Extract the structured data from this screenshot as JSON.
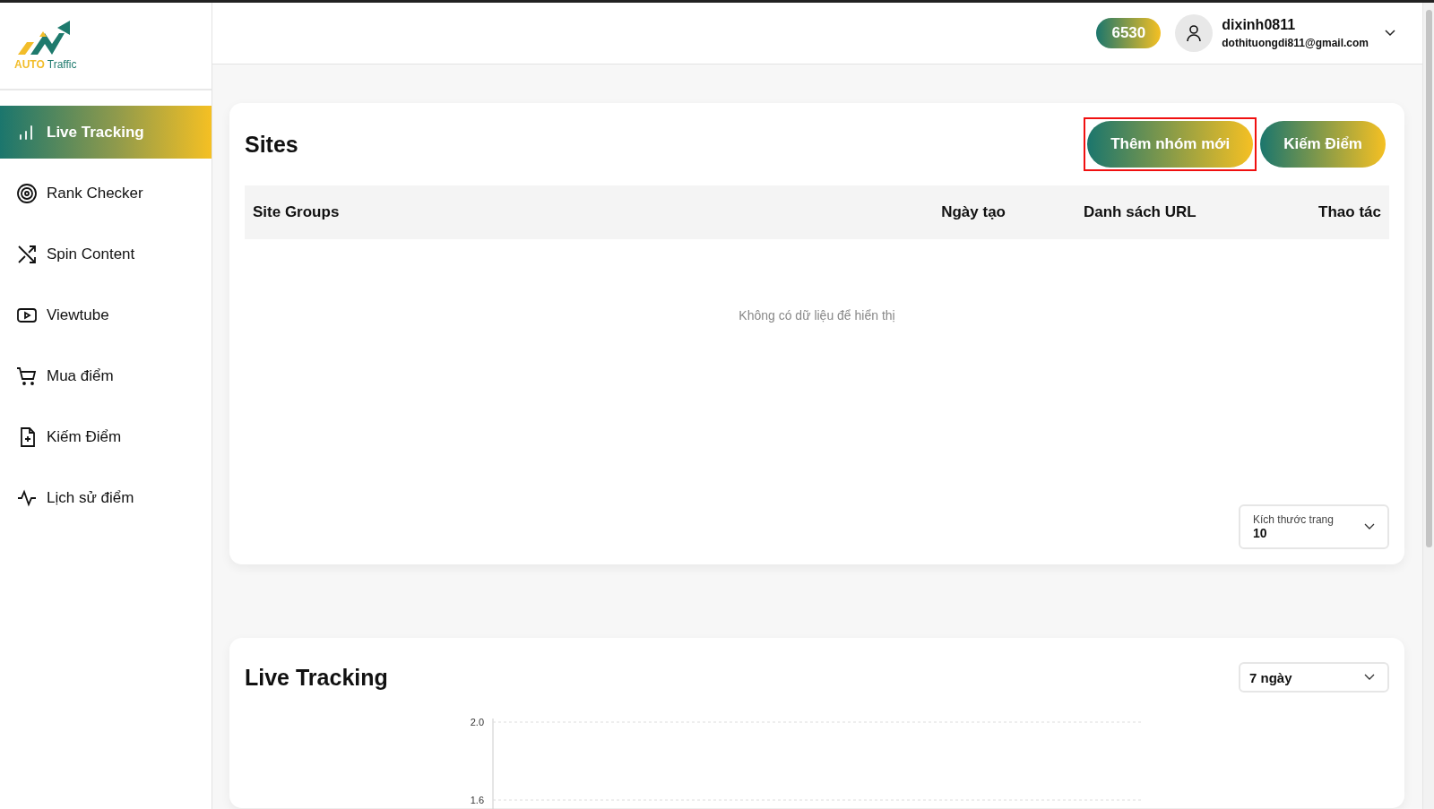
{
  "logo": {
    "word_1": "AUTO",
    "word_2": "Traffic"
  },
  "sidebar": {
    "items": [
      {
        "label": "Live Tracking",
        "selected": true
      },
      {
        "label": "Rank Checker",
        "selected": false
      },
      {
        "label": "Spin Content",
        "selected": false
      },
      {
        "label": "Viewtube",
        "selected": false
      },
      {
        "label": "Mua điểm",
        "selected": false
      },
      {
        "label": "Kiếm Điểm",
        "selected": false
      },
      {
        "label": "Lịch sử điểm",
        "selected": false
      }
    ]
  },
  "header": {
    "points": "6530",
    "username": "dixinh0811",
    "email": "dothituongdi811@gmail.com"
  },
  "sites": {
    "title": "Sites",
    "buttons": [
      {
        "label": "Thêm nhóm mới",
        "highlighted": true
      },
      {
        "label": "Kiếm Điểm",
        "highlighted": false
      }
    ],
    "table": {
      "columns": [
        "Site Groups",
        "Ngày tạo",
        "Danh sách URL",
        "Thao tác"
      ],
      "empty_text": "Không có dữ liệu để hiển thị"
    },
    "page_size": {
      "label": "Kích thước trang",
      "value": "10"
    }
  },
  "live_tracking": {
    "title": "Live Tracking",
    "range": "7 ngày",
    "chart_axis_labels": [
      "2.0",
      "1.6"
    ]
  }
}
